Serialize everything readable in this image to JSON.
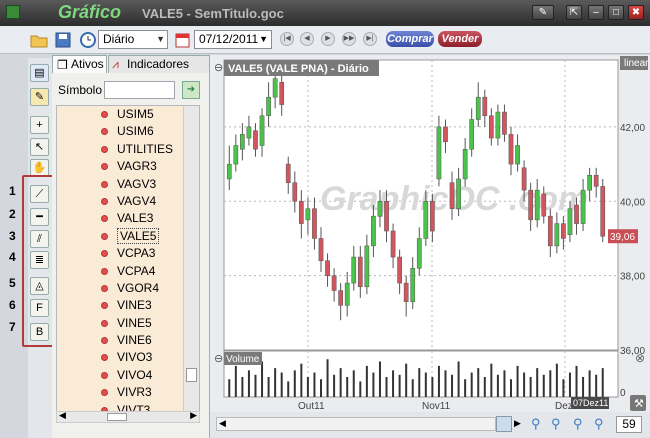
{
  "window": {
    "app_name": "Gráfico",
    "document_title": "VALE5 - SemTitulo.goc"
  },
  "toolbar": {
    "period": "Diário",
    "date": "07/12/2011",
    "buy_label": "Comprar",
    "sell_label": "Vender"
  },
  "panel": {
    "tabs": [
      "Ativos",
      "Indicadores"
    ],
    "symbol_label": "Símbolo",
    "symbol_value": "",
    "selected": "VALE5",
    "symbols": [
      "USIM5",
      "USIM6",
      "UTILITIES",
      "VAGR3",
      "VAGV3",
      "VAGV4",
      "VALE3",
      "VALE5",
      "VCPA3",
      "VCPA4",
      "VGOR4",
      "VINE3",
      "VINE5",
      "VINE6",
      "VIVO3",
      "VIVO4",
      "VIVR3",
      "VIVT3"
    ]
  },
  "tool_numbers": [
    "1",
    "2",
    "3",
    "4",
    "5",
    "6",
    "7"
  ],
  "chart": {
    "header": "VALE5 (VALE     PNA) - Diário",
    "scale_label": "linear",
    "last_price_label": "39,06",
    "volume_label": "Volume",
    "date_label": "07Dez11",
    "watermark": "GraphicOC .com",
    "zoom": "59"
  },
  "chart_data": {
    "type": "candlestick",
    "y_ticks": [
      "42,00",
      "40,00",
      "38,00",
      "36,00"
    ],
    "ylim": [
      36.0,
      43.8
    ],
    "x_ticks": [
      "Out11",
      "Nov11",
      "Dez"
    ],
    "volume_ticks": [
      "0"
    ],
    "last_price": 39.06,
    "candles": [
      {
        "o": 40.6,
        "c": 41.0,
        "h": 41.5,
        "l": 40.3
      },
      {
        "o": 41.0,
        "c": 41.5,
        "h": 41.8,
        "l": 40.8
      },
      {
        "o": 41.4,
        "c": 41.8,
        "h": 42.1,
        "l": 41.1
      },
      {
        "o": 41.7,
        "c": 42.0,
        "h": 42.3,
        "l": 41.5
      },
      {
        "o": 41.9,
        "c": 41.4,
        "h": 42.1,
        "l": 41.2
      },
      {
        "o": 41.5,
        "c": 42.3,
        "h": 42.5,
        "l": 41.2
      },
      {
        "o": 42.3,
        "c": 42.8,
        "h": 43.2,
        "l": 42.0
      },
      {
        "o": 42.8,
        "c": 43.3,
        "h": 43.8,
        "l": 42.5
      },
      {
        "o": 43.2,
        "c": 42.6,
        "h": 43.4,
        "l": 42.3
      },
      {
        "o": 41.0,
        "c": 40.5,
        "h": 41.2,
        "l": 40.2
      },
      {
        "o": 40.5,
        "c": 40.0,
        "h": 40.8,
        "l": 39.7
      },
      {
        "o": 40.0,
        "c": 39.4,
        "h": 40.3,
        "l": 39.0
      },
      {
        "o": 39.5,
        "c": 39.8,
        "h": 40.1,
        "l": 39.1
      },
      {
        "o": 39.8,
        "c": 39.0,
        "h": 40.1,
        "l": 38.7
      },
      {
        "o": 39.0,
        "c": 38.4,
        "h": 39.3,
        "l": 38.1
      },
      {
        "o": 38.4,
        "c": 38.0,
        "h": 38.6,
        "l": 37.7
      },
      {
        "o": 38.0,
        "c": 37.6,
        "h": 38.2,
        "l": 37.3
      },
      {
        "o": 37.6,
        "c": 37.2,
        "h": 37.8,
        "l": 36.8
      },
      {
        "o": 37.2,
        "c": 37.8,
        "h": 38.1,
        "l": 36.9
      },
      {
        "o": 37.8,
        "c": 38.5,
        "h": 38.8,
        "l": 37.6
      },
      {
        "o": 38.5,
        "c": 37.7,
        "h": 38.8,
        "l": 37.4
      },
      {
        "o": 37.7,
        "c": 38.8,
        "h": 39.1,
        "l": 37.5
      },
      {
        "o": 38.8,
        "c": 39.6,
        "h": 39.9,
        "l": 38.5
      },
      {
        "o": 39.6,
        "c": 40.0,
        "h": 40.3,
        "l": 39.3
      },
      {
        "o": 40.0,
        "c": 39.2,
        "h": 40.3,
        "l": 38.9
      },
      {
        "o": 39.2,
        "c": 38.5,
        "h": 39.4,
        "l": 38.2
      },
      {
        "o": 38.5,
        "c": 37.8,
        "h": 38.7,
        "l": 37.5
      },
      {
        "o": 37.8,
        "c": 37.3,
        "h": 38.0,
        "l": 36.9
      },
      {
        "o": 37.3,
        "c": 38.2,
        "h": 38.5,
        "l": 37.1
      },
      {
        "o": 38.2,
        "c": 39.0,
        "h": 39.3,
        "l": 38.0
      },
      {
        "o": 39.0,
        "c": 40.0,
        "h": 40.3,
        "l": 38.8
      },
      {
        "o": 40.0,
        "c": 39.2,
        "h": 40.2,
        "l": 38.9
      },
      {
        "o": 40.6,
        "c": 42.0,
        "h": 42.3,
        "l": 40.4
      },
      {
        "o": 42.0,
        "c": 41.6,
        "h": 42.2,
        "l": 41.3
      },
      {
        "o": 40.5,
        "c": 39.8,
        "h": 40.8,
        "l": 39.5
      },
      {
        "o": 39.8,
        "c": 40.6,
        "h": 40.9,
        "l": 39.6
      },
      {
        "o": 40.6,
        "c": 41.4,
        "h": 41.7,
        "l": 40.4
      },
      {
        "o": 41.4,
        "c": 42.2,
        "h": 42.5,
        "l": 41.2
      },
      {
        "o": 42.2,
        "c": 42.8,
        "h": 43.2,
        "l": 42.0
      },
      {
        "o": 42.8,
        "c": 42.3,
        "h": 43.0,
        "l": 42.0
      },
      {
        "o": 42.3,
        "c": 41.7,
        "h": 42.5,
        "l": 41.5
      },
      {
        "o": 41.7,
        "c": 42.4,
        "h": 42.6,
        "l": 41.5
      },
      {
        "o": 42.4,
        "c": 41.8,
        "h": 42.6,
        "l": 41.6
      },
      {
        "o": 41.8,
        "c": 41.0,
        "h": 42.0,
        "l": 40.7
      },
      {
        "o": 41.0,
        "c": 41.5,
        "h": 41.8,
        "l": 40.8
      },
      {
        "o": 40.9,
        "c": 40.3,
        "h": 41.1,
        "l": 40.0
      },
      {
        "o": 40.3,
        "c": 39.5,
        "h": 40.5,
        "l": 39.2
      },
      {
        "o": 39.5,
        "c": 40.3,
        "h": 40.6,
        "l": 39.3
      },
      {
        "o": 40.2,
        "c": 39.6,
        "h": 40.4,
        "l": 39.4
      },
      {
        "o": 39.6,
        "c": 38.8,
        "h": 39.8,
        "l": 38.5
      },
      {
        "o": 38.8,
        "c": 39.4,
        "h": 39.7,
        "l": 38.6
      },
      {
        "o": 39.4,
        "c": 39.0,
        "h": 39.6,
        "l": 38.7
      },
      {
        "o": 39.1,
        "c": 39.8,
        "h": 40.0,
        "l": 38.9
      },
      {
        "o": 39.9,
        "c": 39.4,
        "h": 40.1,
        "l": 39.1
      },
      {
        "o": 39.4,
        "c": 40.3,
        "h": 40.6,
        "l": 39.2
      },
      {
        "o": 40.3,
        "c": 40.7,
        "h": 40.9,
        "l": 40.0
      },
      {
        "o": 40.7,
        "c": 40.4,
        "h": 40.9,
        "l": 40.1
      },
      {
        "o": 40.4,
        "c": 39.06,
        "h": 40.6,
        "l": 38.9
      }
    ],
    "volumes": [
      8,
      14,
      9,
      12,
      10,
      16,
      9,
      13,
      11,
      7,
      12,
      15,
      9,
      11,
      8,
      17,
      10,
      13,
      9,
      12,
      7,
      14,
      11,
      16,
      9,
      12,
      10,
      15,
      8,
      13,
      11,
      9,
      14,
      12,
      10,
      16,
      8,
      11,
      13,
      9,
      15,
      10,
      12,
      8,
      14,
      11,
      9,
      13,
      10,
      12,
      15,
      8,
      11,
      14,
      9,
      12,
      10,
      13
    ],
    "volume_max": 18,
    "colors": {
      "up": "#4cc24c",
      "down": "#d1565e",
      "grid": "#b8b8b8"
    }
  }
}
